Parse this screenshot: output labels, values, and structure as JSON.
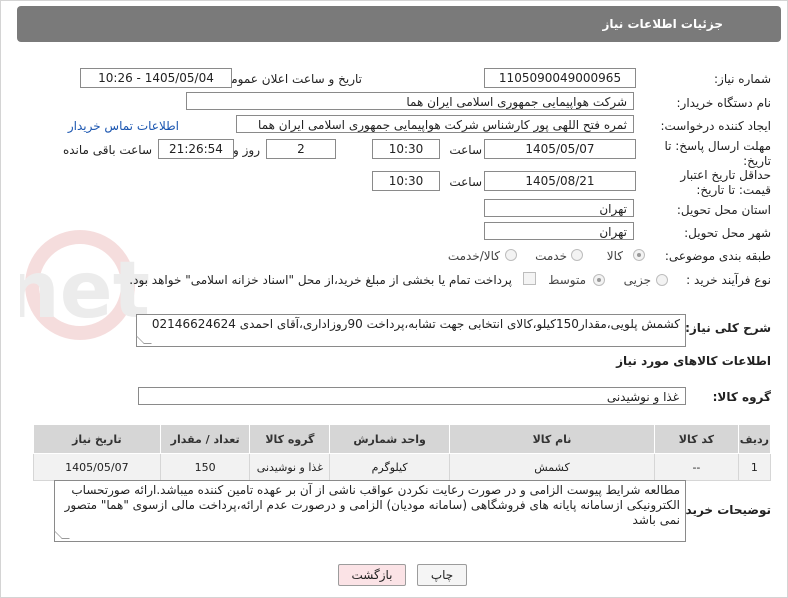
{
  "header": {
    "title": "جزئیات اطلاعات نیاز"
  },
  "fields": {
    "need_number_label": "شماره نیاز:",
    "need_number": "1105090049000965",
    "announce_label": "تاریخ و ساعت اعلان عمومی:",
    "announce_value": "1405/05/04 - 10:26",
    "buyer_org_label": "نام دستگاه خریدار:",
    "buyer_org": "شرکت هواپیمایی جمهوری اسلامی ایران هما",
    "creator_label": "ایجاد کننده درخواست:",
    "creator": "ثمره فتح اللهی پور کارشناس شرکت هواپیمایی جمهوری اسلامی ایران هما",
    "buyer_contact_link": "اطلاعات تماس خریدار",
    "reply_deadline_label": "مهلت ارسال پاسخ: تا تاریخ:",
    "reply_date": "1405/05/07",
    "time_label": "ساعت",
    "reply_time": "10:30",
    "days_value": "2",
    "days_label": "روز و",
    "remaining_time": "21:26:54",
    "remaining_label": "ساعت باقی مانده",
    "price_validity_label": "حداقل تاریخ اعتبار قیمت: تا تاریخ:",
    "price_date": "1405/08/21",
    "price_time": "10:30",
    "province_label": "استان محل تحویل:",
    "province": "تهران",
    "city_label": "شهر محل تحویل:",
    "city": "تهران",
    "category_label": "طبقه بندی موضوعی:",
    "category_options": [
      "کالا",
      "خدمت",
      "کالا/خدمت"
    ],
    "category_selected": "کالا",
    "process_label": "نوع فرآیند خرید :",
    "process_options": [
      "جزیی",
      "متوسط"
    ],
    "process_selected": "متوسط",
    "payment_note": "پرداخت تمام یا بخشی از مبلغ خرید،از محل \"اسناد خزانه اسلامی\" خواهد بود."
  },
  "summary": {
    "label": "شرح کلی نیاز:",
    "text": "کشمش پلویی،مقدار150کیلو،کالای انتخابی جهت تشابه،پرداخت 90روزاداری،آقای احمدی 02146624624"
  },
  "goods": {
    "section_title": "اطلاعات کالاهای مورد نیاز",
    "group_label": "گروه کالا:",
    "group_value": "غذا و نوشیدنی",
    "columns": [
      "ردیف",
      "کد کالا",
      "نام کالا",
      "واحد شمارش",
      "گروه کالا",
      "تعداد / مقدار",
      "تاریخ نیاز"
    ],
    "rows": [
      [
        "1",
        "--",
        "کشمش",
        "کیلوگرم",
        "غذا و نوشیدنی",
        "150",
        "1405/05/07"
      ]
    ]
  },
  "buyer_notes": {
    "label": "توضیحات خریدار:",
    "text": "مطالعه شرایط پیوست الزامی و در صورت رعایت نکردن عواقب ناشی از آن بر عهده تامین کننده میباشد.ارائه صورتحساب الکترونیکی ازسامانه پایانه های فروشگاهی (سامانه مودیان) الزامی و درصورت عدم ارائه،پرداخت مالی ازسوی \"هما\" متصور نمی باشد"
  },
  "buttons": {
    "print": "چاپ",
    "back": "بازگشت"
  },
  "watermark_text": "AriaTender.net"
}
